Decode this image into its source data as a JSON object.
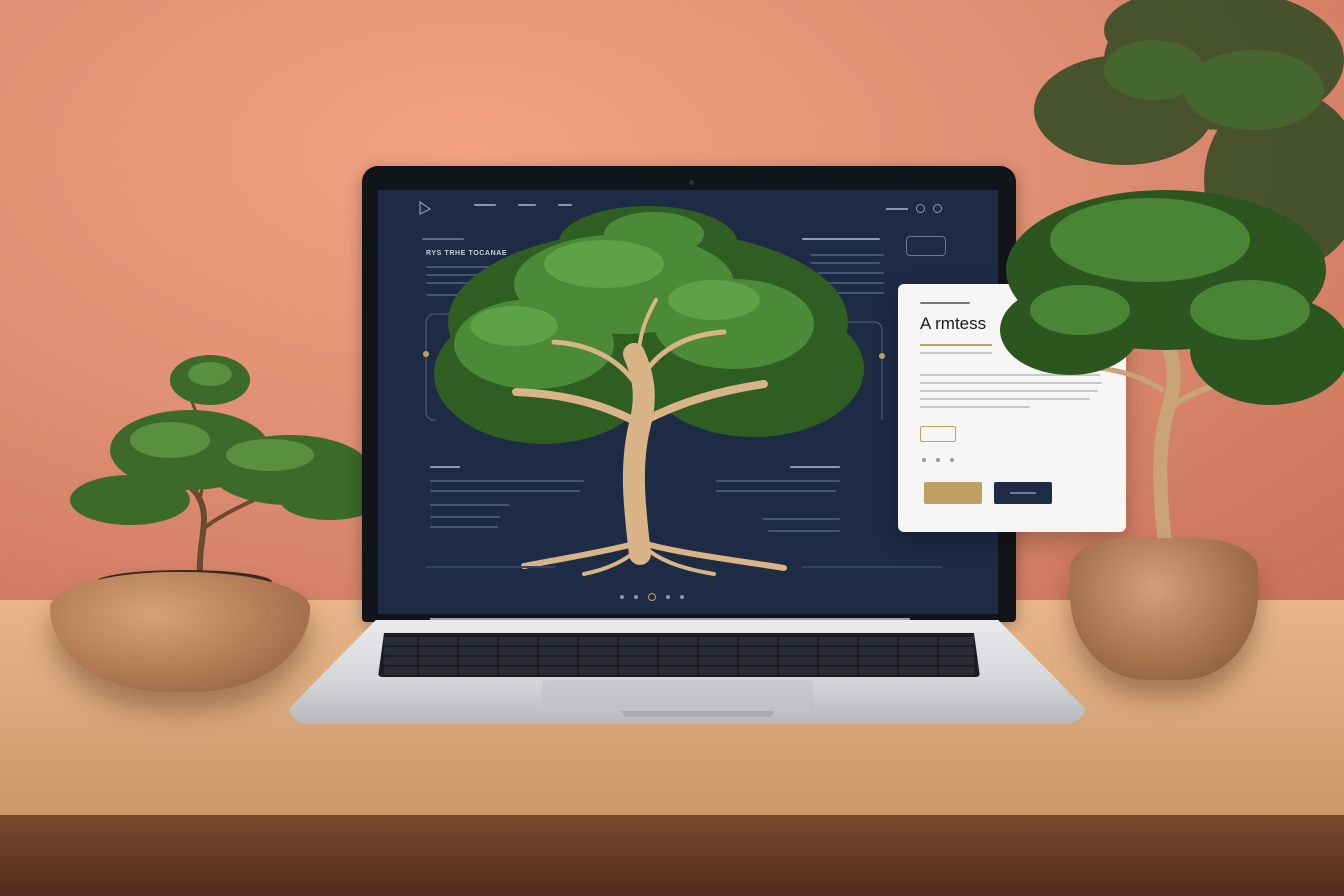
{
  "scene": {
    "description_colors": {
      "wall": "#e09074",
      "desk": "#dcaa7e",
      "screen_bg": "#1d2b45",
      "accent_gold": "#c5a063",
      "foliage": "#3f7a2c",
      "trunk": "#d8b487"
    }
  },
  "screen": {
    "nav": {
      "logo_icon": "triangle-logo-icon",
      "links": [
        "",
        "",
        ""
      ],
      "right_icons": [
        "search-icon",
        "user-icon"
      ]
    },
    "hero_heading": "RYS TRHE TOCANAE",
    "side_button": "",
    "label_left": "",
    "label_right": "",
    "pager": {
      "dots": 5
    }
  },
  "card": {
    "eyebrow": "",
    "title": "A rmtess",
    "primary_button": "",
    "secondary_button": ""
  }
}
